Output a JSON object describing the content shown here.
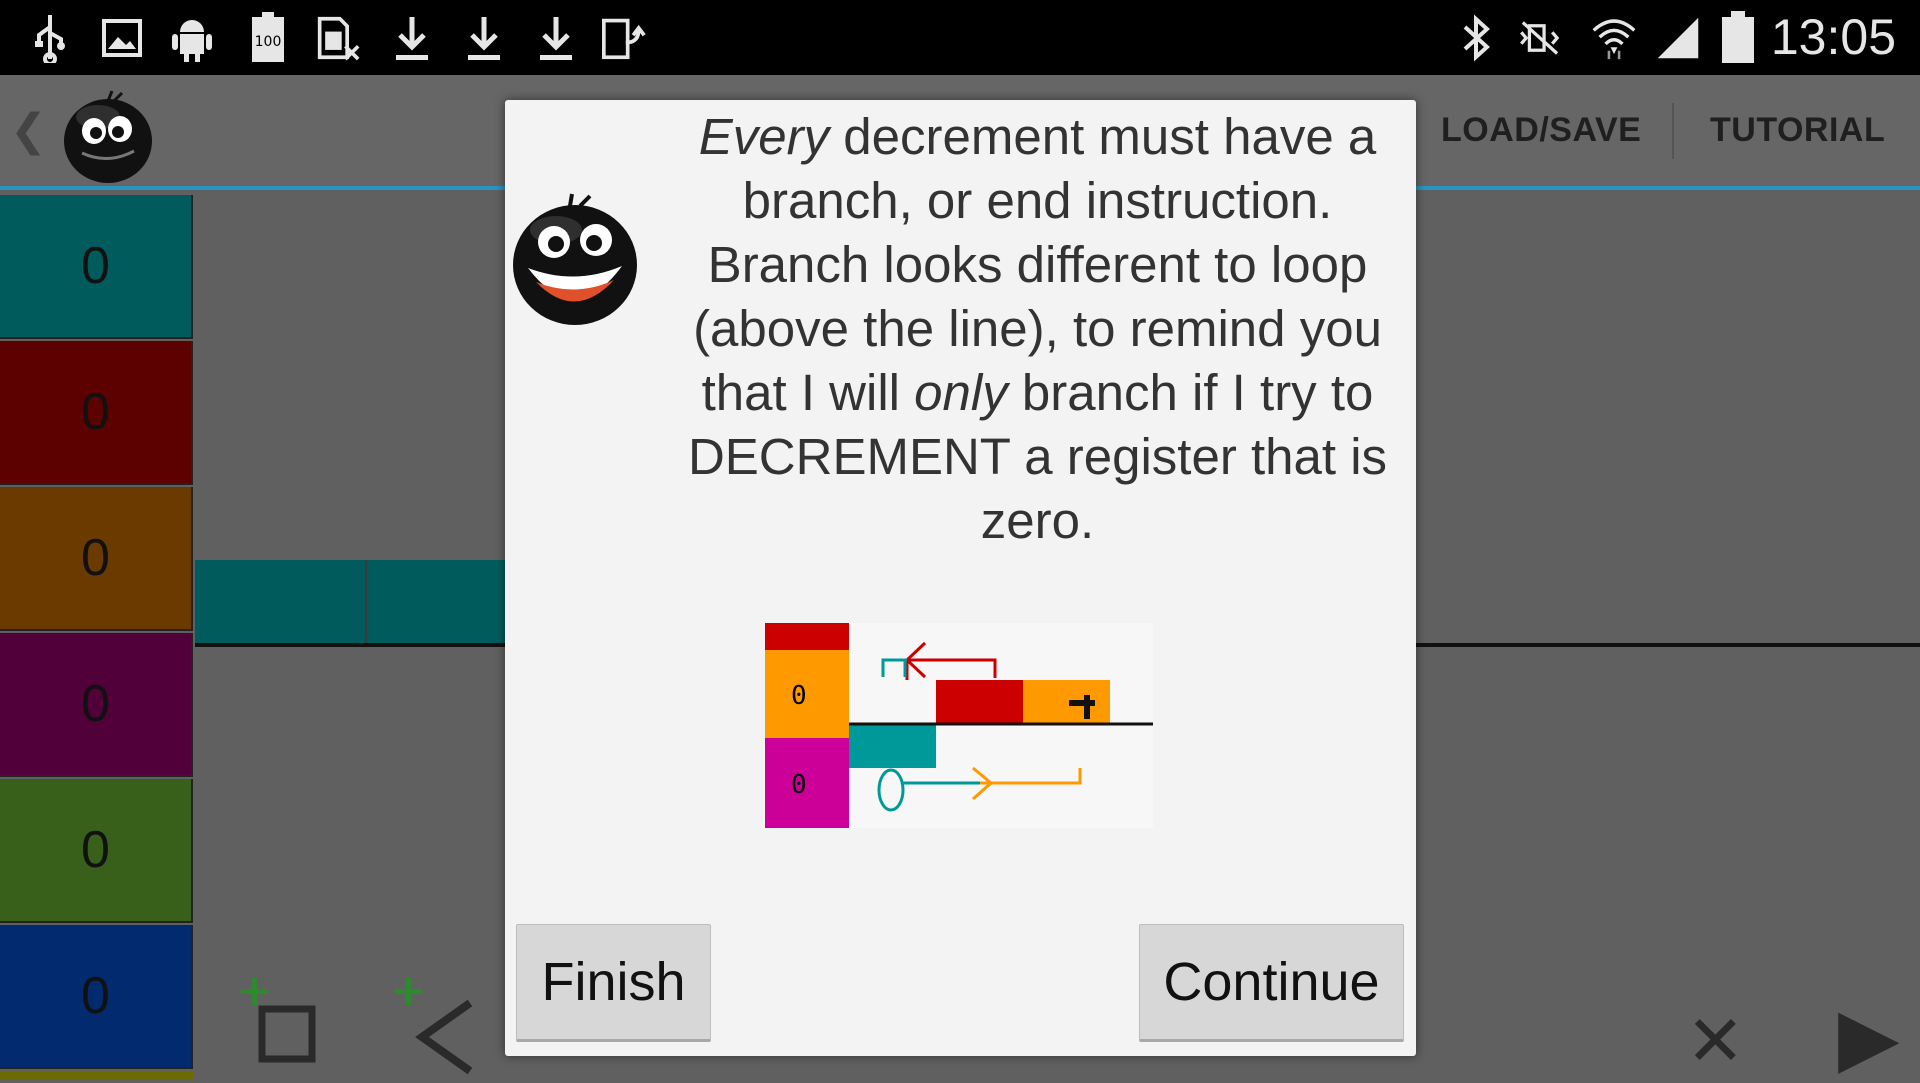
{
  "status_bar": {
    "time": "13:05",
    "left_icons": [
      "usb-icon",
      "image-icon",
      "android-icon",
      "battery-100-icon",
      "sim-off-icon",
      "download-icon",
      "download-icon",
      "download-icon",
      "screen-rotate-icon"
    ],
    "right_icons": [
      "bluetooth-icon",
      "mute-icon",
      "wifi-icon",
      "signal-icon",
      "battery-icon"
    ],
    "battery_label": "100"
  },
  "action_bar": {
    "back_glyph": "❮",
    "load_save_label": "LOAD/SAVE",
    "tutorial_label": "TUTORIAL"
  },
  "registers": [
    {
      "value": "0",
      "color": "#005c5c"
    },
    {
      "value": "0",
      "color": "#5c0000"
    },
    {
      "value": "0",
      "color": "#6b3a00"
    },
    {
      "value": "0",
      "color": "#520039"
    },
    {
      "value": "0",
      "color": "#38601a"
    },
    {
      "value": "0",
      "color": "#012b6e"
    }
  ],
  "bottom_toolbar": {
    "add_register_plus": "+",
    "add_instruction_plus": "+",
    "delete_glyph": "✕",
    "play_glyph": "▶"
  },
  "dialog": {
    "message": {
      "every": "Every",
      "part1": " decrement must have a branch, or end instruction. Branch looks different to loop (above the line), to remind you that I will ",
      "only": "only",
      "part2": " branch if I try to DECREMENT a register that is zero."
    },
    "diagram_labels": {
      "top_register": "0",
      "bottom_register": "0"
    },
    "finish_label": "Finish",
    "continue_label": "Continue"
  },
  "colors": {
    "accent": "#2b93c2",
    "teal": "#009999",
    "red": "#cc0000",
    "orange": "#ff9900",
    "magenta": "#cc0099"
  }
}
